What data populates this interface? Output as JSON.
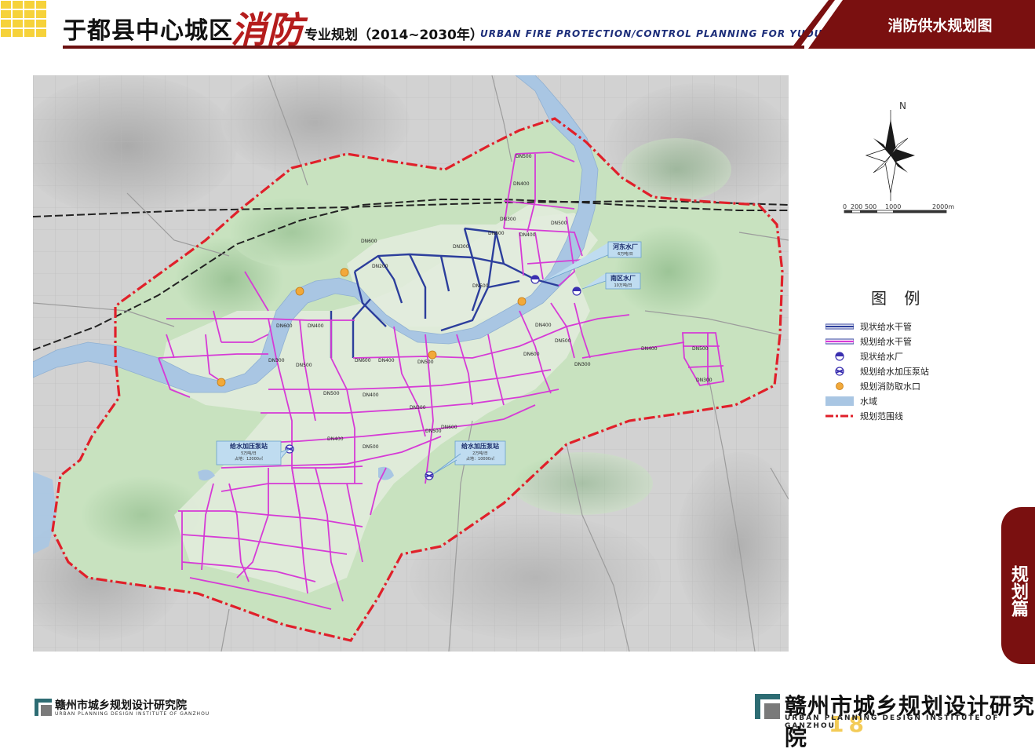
{
  "header": {
    "title_cn": "于都县中心城区",
    "title_fire": "消防",
    "title_sub": "专业规划（2014~2030年）",
    "title_en": "URBAN FIRE PROTECTION/CONTROL PLANNING FOR YUDU CITY",
    "sheet_title": "消防供水规划图",
    "accent_color": "#7a1010",
    "fire_color": "#b51d1d"
  },
  "compass": {
    "north": "N"
  },
  "scale": {
    "ticks": [
      "0",
      "200",
      "500",
      "1000",
      "2000m"
    ]
  },
  "legend": {
    "title": "图 例",
    "items": [
      {
        "label": "现状给水干管",
        "symbol": "line",
        "color": "#2c3e9c"
      },
      {
        "label": "规划给水干管",
        "symbol": "line",
        "color": "#d63bd6"
      },
      {
        "label": "现状给水厂",
        "symbol": "half-circle",
        "color": "#3a2fb0"
      },
      {
        "label": "规划给水加压泵站",
        "symbol": "pump",
        "color": "#3a2fb0"
      },
      {
        "label": "规划消防取水口",
        "symbol": "dot",
        "color": "#f2a93a"
      },
      {
        "label": "水域",
        "symbol": "area",
        "color": "#a9c6e3"
      },
      {
        "label": "规划范围线",
        "symbol": "dash-dot",
        "color": "#e0202a"
      }
    ]
  },
  "map_labels": {
    "hedong_plant": {
      "name": "河东水厂",
      "capacity": "6万吨/日"
    },
    "nanqu_plant": {
      "name": "南区水厂",
      "capacity": "10万吨/日"
    },
    "pump_west": {
      "name": "给水加压泵站",
      "capacity": "5万吨/日",
      "area": "占地：12000㎡"
    },
    "pump_south": {
      "name": "给水加压泵站",
      "capacity": "2万吨/日",
      "area": "占地：10000㎡"
    },
    "pipes": [
      "DN500",
      "DN400",
      "DN300",
      "DN200",
      "DN600",
      "DN800",
      "DN500",
      "DN400",
      "DN300",
      "DN500",
      "DN600",
      "DN400",
      "DN300",
      "DN500",
      "DN600",
      "DN400",
      "DN500",
      "DN600",
      "DN500",
      "DN400",
      "DN300",
      "DN500",
      "DN400",
      "DN500",
      "DN600",
      "DN400",
      "DN500",
      "DN300",
      "DN400",
      "DN500",
      "DN300"
    ]
  },
  "side_tab": {
    "label": "规划篇"
  },
  "footer": {
    "left_cn": "赣州市城乡规划设计研究院",
    "left_en": "URBAN PLANNING DESIGN INSTITUTE OF GANZHOU",
    "right_cn": "赣州市城乡规划设计研究院",
    "right_en": "URBAN PLANNING DESIGN INSTITUTE OF GANZHOU",
    "page_number": "18"
  }
}
